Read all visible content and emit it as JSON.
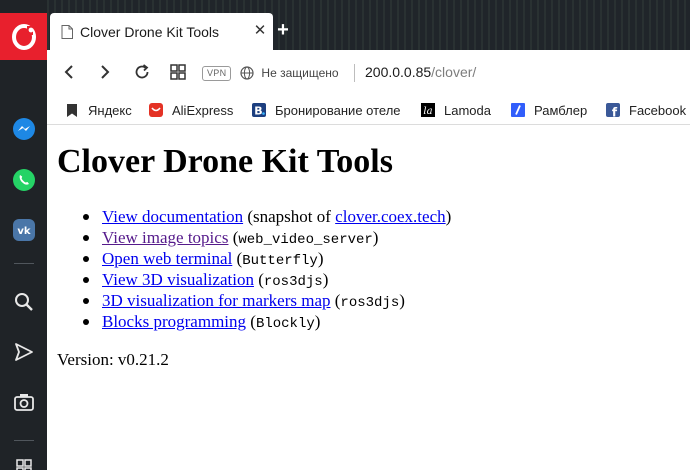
{
  "browser": {
    "tab": {
      "title": "Clover Drone Kit Tools",
      "close": "✕"
    },
    "new_tab": "+",
    "address": {
      "vpn": "VPN",
      "security": "Не защищено",
      "host": "200.0.0.85",
      "path": "/clover/"
    },
    "bookmarks": [
      {
        "label": "Яндекс",
        "icon": "yandex-icon"
      },
      {
        "label": "AliExpress",
        "icon": "aliexpress-icon",
        "color": "#e43225"
      },
      {
        "label": "Бронирование отеле",
        "icon": "booking-icon",
        "color": "#1d3f80"
      },
      {
        "label": "Lamoda",
        "icon": "lamoda-icon",
        "color": "#000000"
      },
      {
        "label": "Рамблер",
        "icon": "rambler-icon",
        "color": "#315efb"
      },
      {
        "label": "Facebook",
        "icon": "facebook-icon",
        "color": "#3b5998"
      }
    ]
  },
  "sidebar": {
    "items": [
      "opera-logo",
      "messenger-icon",
      "whatsapp-icon",
      "vk-icon",
      "search-icon",
      "send-icon",
      "camera-icon",
      "grid-icon"
    ]
  },
  "page": {
    "title": "Clover Drone Kit Tools",
    "links": [
      {
        "text": "View documentation",
        "pre": " (snapshot of ",
        "link2": "clover.coex.tech",
        "post": ")"
      },
      {
        "text": "View image topics",
        "pre": " (",
        "code": "web_video_server",
        "post": ")"
      },
      {
        "text": "Open web terminal",
        "pre": " (",
        "code": "Butterfly",
        "post": ")"
      },
      {
        "text": "View 3D visualization",
        "pre": " (",
        "code": "ros3djs",
        "post": ")"
      },
      {
        "text": "3D visualization for markers map",
        "pre": " (",
        "code": "ros3djs",
        "post": ")"
      },
      {
        "text": "Blocks programming",
        "pre": " (",
        "code": "Blockly",
        "post": ")"
      }
    ],
    "version": "Version: v0.21.2"
  }
}
